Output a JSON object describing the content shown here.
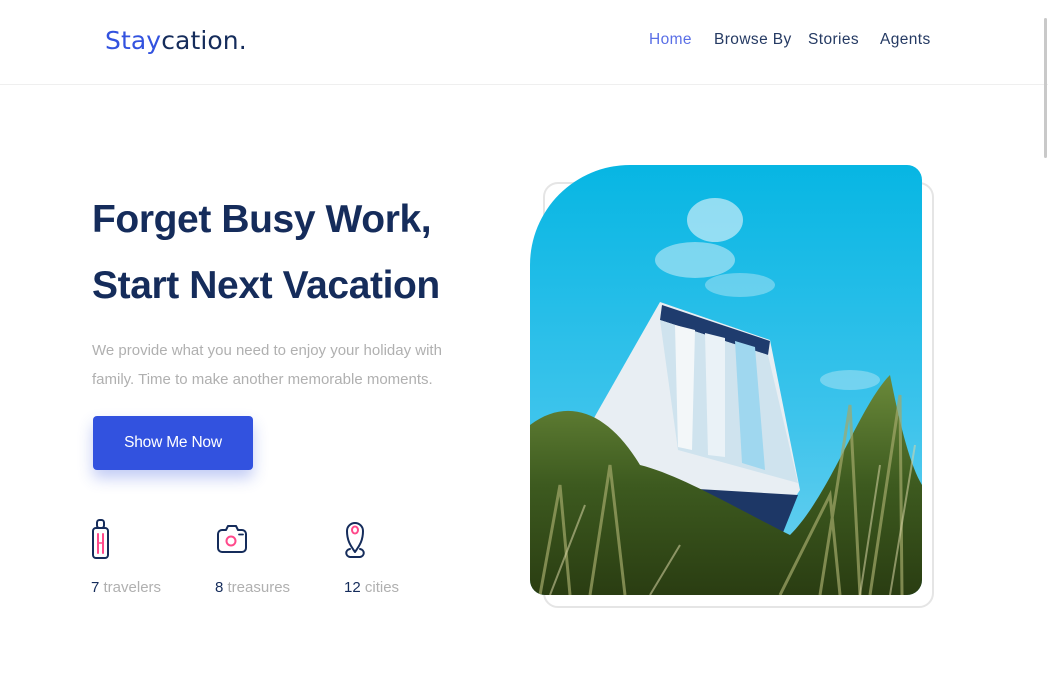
{
  "header": {
    "logo": {
      "accent": "Stay",
      "rest": "cation."
    },
    "nav": [
      {
        "label": "Home",
        "active": true
      },
      {
        "label": "Browse By",
        "active": false
      },
      {
        "label": "Stories",
        "active": false
      },
      {
        "label": "Agents",
        "active": false
      }
    ]
  },
  "hero": {
    "title_line1": "Forget Busy Work,",
    "title_line2": "Start Next Vacation",
    "description": "We provide what you need to enjoy your holiday with family. Time to make another memorable moments.",
    "cta_label": "Show Me Now",
    "image_alt": "Glass-walled cabin on a grassy hill under a blue sky"
  },
  "stats": [
    {
      "icon": "suitcase-icon",
      "value": "7",
      "unit": "travelers"
    },
    {
      "icon": "camera-icon",
      "value": "8",
      "unit": "treasures"
    },
    {
      "icon": "map-pin-icon",
      "value": "12",
      "unit": "cities"
    }
  ],
  "colors": {
    "primary": "#3252df",
    "heading": "#152c5b",
    "muted": "#b0b0b0",
    "icon_accent": "#ff498b",
    "nav_active": "#5a6fe6"
  }
}
